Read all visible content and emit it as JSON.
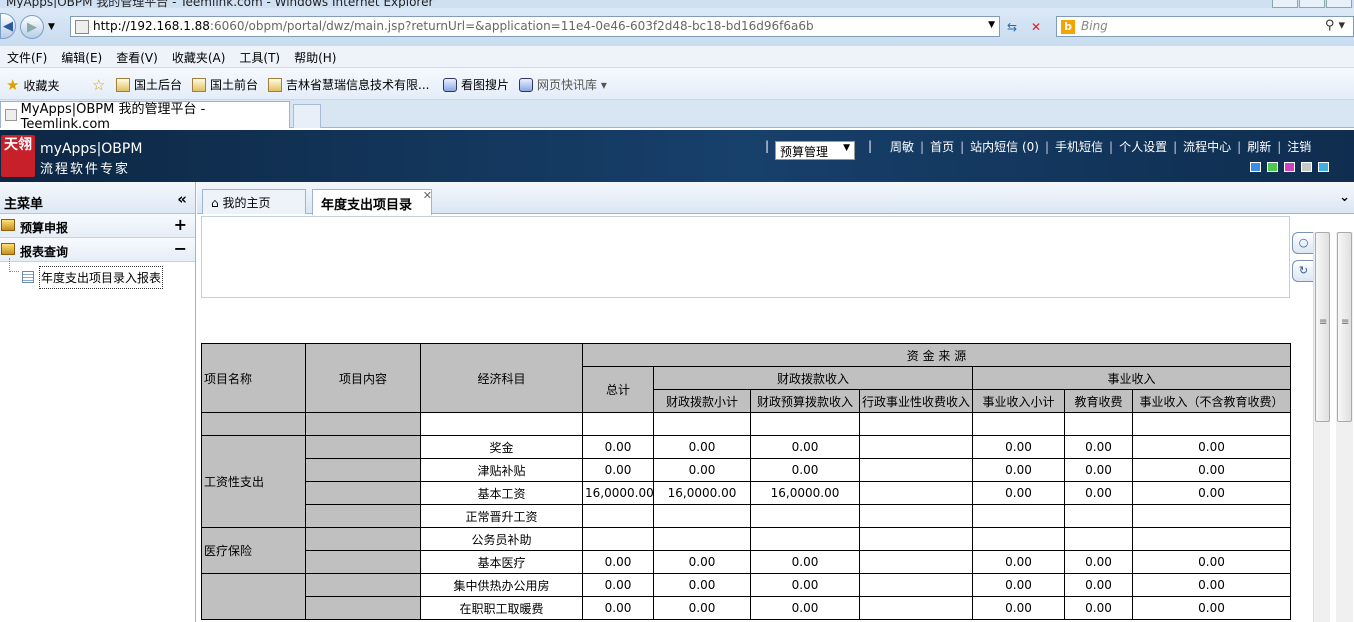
{
  "browser": {
    "window_title": "MyApps|OBPM 我的管理平台 - Teemlink.com - Windows Internet Explorer",
    "url_host": "http://192.168.1.88",
    "url_rest": ":6060/obpm/portal/dwz/main.jsp?returnUrl=&application=11e4-0e46-603f2d48-bc18-bd16d96f6a6b",
    "search_placeholder": "Bing",
    "menu": [
      "文件(F)",
      "编辑(E)",
      "查看(V)",
      "收藏夹(A)",
      "工具(T)",
      "帮助(H)"
    ],
    "favorites_label": "收藏夹",
    "favorites": [
      "国土后台",
      "国土前台",
      "吉林省慧瑞信息技术有限...",
      "看图搜片",
      "网页快讯库 ▾"
    ],
    "tab_title": "MyApps|OBPM 我的管理平台 - Teemlink.com"
  },
  "app": {
    "logo_mark": "天翎",
    "logo_line1": "myApps|OBPM",
    "logo_line2": "流程软件专家",
    "module_select": "预算管理",
    "top_links": [
      "周敏",
      "首页",
      "站内短信 (0)",
      "手机短信",
      "个人设置",
      "流程中心",
      "刷新",
      "注销"
    ],
    "theme_colors": [
      "#3a8ee6",
      "#4dc94d",
      "#d040c0",
      "#c8c8c8",
      "#40b0e0"
    ]
  },
  "sidebar": {
    "title": "主菜单",
    "groups": [
      {
        "label": "预算申报",
        "toggle": "+"
      },
      {
        "label": "报表查询",
        "toggle": "−"
      }
    ],
    "tree_item": "年度支出项目录入报表"
  },
  "tabs": {
    "home": "我的主页",
    "active": "年度支出项目录"
  },
  "report": {
    "headers": {
      "project_name": "项目名称",
      "project_content": "项目内容",
      "economic_subject": "经济科目",
      "fund_source": "资  金  来  源",
      "total": "总计",
      "fiscal": "财政拨款收入",
      "business": "事业收入",
      "sub": [
        "财政拨款小计",
        "财政预算拨款收入",
        "行政事业性收费收入",
        "事业收入小计",
        "教育收费",
        "事业收入（不含教育收费）"
      ]
    },
    "groups": [
      "工资性支出",
      "医疗保险"
    ],
    "rows": [
      {
        "subject": "奖金",
        "v": [
          "0.00",
          "0.00",
          "0.00",
          "",
          "0.00",
          "0.00",
          "0.00"
        ]
      },
      {
        "subject": "津贴补贴",
        "v": [
          "0.00",
          "0.00",
          "0.00",
          "",
          "0.00",
          "0.00",
          "0.00"
        ]
      },
      {
        "subject": "基本工资",
        "v": [
          "16,0000.00",
          "16,0000.00",
          "16,0000.00",
          "",
          "0.00",
          "0.00",
          "0.00"
        ]
      },
      {
        "subject": "正常晋升工资",
        "v": [
          "",
          "",
          "",
          "",
          "",
          "",
          ""
        ]
      },
      {
        "subject": "公务员补助",
        "v": [
          "",
          "",
          "",
          "",
          "",
          "",
          ""
        ]
      },
      {
        "subject": "基本医疗",
        "v": [
          "0.00",
          "0.00",
          "0.00",
          "",
          "0.00",
          "0.00",
          "0.00"
        ]
      },
      {
        "subject": "集中供热办公用房",
        "v": [
          "0.00",
          "0.00",
          "0.00",
          "",
          "0.00",
          "0.00",
          "0.00"
        ]
      },
      {
        "subject": "在职职工取暖费",
        "v": [
          "0.00",
          "0.00",
          "0.00",
          "",
          "0.00",
          "0.00",
          "0.00"
        ]
      }
    ]
  }
}
